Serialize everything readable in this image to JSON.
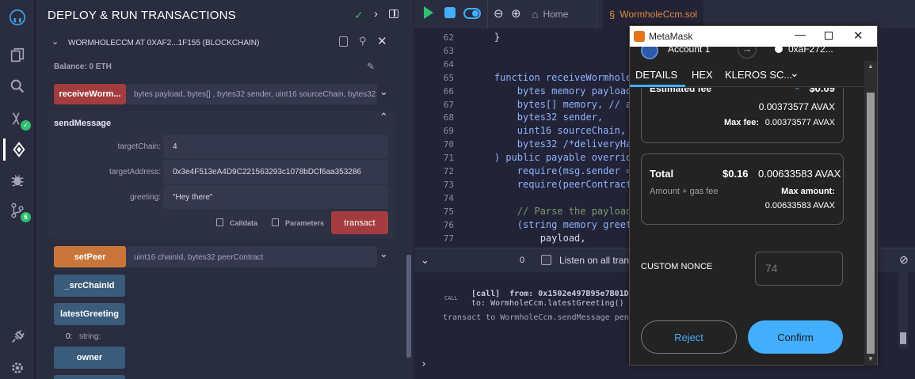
{
  "sidebar_icons": [
    "remix-logo-icon",
    "file-explorer-icon",
    "search-icon",
    "solidity-compiler-icon",
    "deploy-run-icon",
    "debugger-icon",
    "git-icon",
    "plugin-icon",
    "settings-icon"
  ],
  "sidebar_badges": {
    "compiler": "✓",
    "git": "6"
  },
  "panel": {
    "title": "DEPLOY & RUN TRANSACTIONS",
    "contract_title": "WORMHOLECCM AT 0XAF2...1F155 (BLOCKCHAIN)",
    "balance": "Balance: 0 ETH",
    "receive_btn": "receiveWorm...",
    "receive_sig": "bytes payload, bytes[] , bytes32 sender, uint16 sourceChain, bytes32",
    "send_message_label": "sendMessage",
    "fields": [
      {
        "label": "targetChain:",
        "value": "4"
      },
      {
        "label": "targetAddress:",
        "value": "0x3e4F513eA4D9C221563293c1078bDCf6aa353286"
      },
      {
        "label": "greeting:",
        "value": "\"Hey there\""
      }
    ],
    "calldata_label": "Calldata",
    "parameters_label": "Parameters",
    "transact_label": "transact",
    "setpeer_btn": "setPeer",
    "setpeer_sig": "uint16 chainId, bytes32 peerContract",
    "srcchain_btn": "_srcChainId",
    "latest_btn": "latestGreeting",
    "latest_result_index": "0:",
    "latest_result_type": "string:",
    "owner_btn": "owner"
  },
  "editor": {
    "tabs": {
      "home": "Home",
      "file": "WormholeCcm.sol"
    },
    "lines": [
      {
        "n": "62",
        "code": "    }"
      },
      {
        "n": "63",
        "code": ""
      },
      {
        "n": "64",
        "code": ""
      },
      {
        "n": "65",
        "code": "    function receiveWormhole"
      },
      {
        "n": "66",
        "code": "        bytes memory payload"
      },
      {
        "n": "67",
        "code": "        bytes[] memory, // a"
      },
      {
        "n": "68",
        "code": "        bytes32 sender,"
      },
      {
        "n": "69",
        "code": "        uint16 sourceChain,"
      },
      {
        "n": "70",
        "code": "        bytes32 /*deliveryHa"
      },
      {
        "n": "71",
        "code": "    ) public payable override"
      },
      {
        "n": "72",
        "code": "        require(msg.sender =="
      },
      {
        "n": "73",
        "code": "        require(peerContract"
      },
      {
        "n": "74",
        "code": ""
      },
      {
        "n": "75",
        "code": "        // Parse the payload"
      },
      {
        "n": "76",
        "code": "        (string memory greet"
      },
      {
        "n": "77",
        "code": "            payload,"
      }
    ]
  },
  "terminal": {
    "count": "0",
    "listen_label": "Listen on all trans",
    "call_tag": "CALL",
    "call_line1": "[call]  from: 0x1502e497B95e7B01D1",
    "call_line2": "to: WormholeCcm.latestGreeting() d",
    "pending_line": "transact to WormholeCcm.sendMessage pending"
  },
  "metamask": {
    "window_title": "MetaMask",
    "account": "Account 1",
    "address": "0xaF272...",
    "tabs": [
      "DETAILS",
      "HEX",
      "KLEROS SC..."
    ],
    "estimated_fee_label": "Estimated fee",
    "estimated_fee_usd": "$0.09",
    "estimated_fee_avax": "0.00373577 AVAX",
    "max_fee_label": "Max fee:",
    "max_fee_value": "0.00373577 AVAX",
    "total_label": "Total",
    "total_usd": "$0.16",
    "total_avax": "0.00633583 AVAX",
    "amount_gas_label": "Amount + gas fee",
    "max_amount_label": "Max amount:",
    "max_amount_value": "0.00633583 AVAX",
    "custom_nonce_label": "CUSTOM NONCE",
    "nonce_placeholder": "74",
    "reject_label": "Reject",
    "confirm_label": "Confirm"
  },
  "colors": {
    "accent_blue": "#43aefc",
    "transact_red": "#a33c3f",
    "setpeer_orange": "#c97539",
    "call_blue": "#3a5b7a",
    "green": "#2fbf71"
  }
}
